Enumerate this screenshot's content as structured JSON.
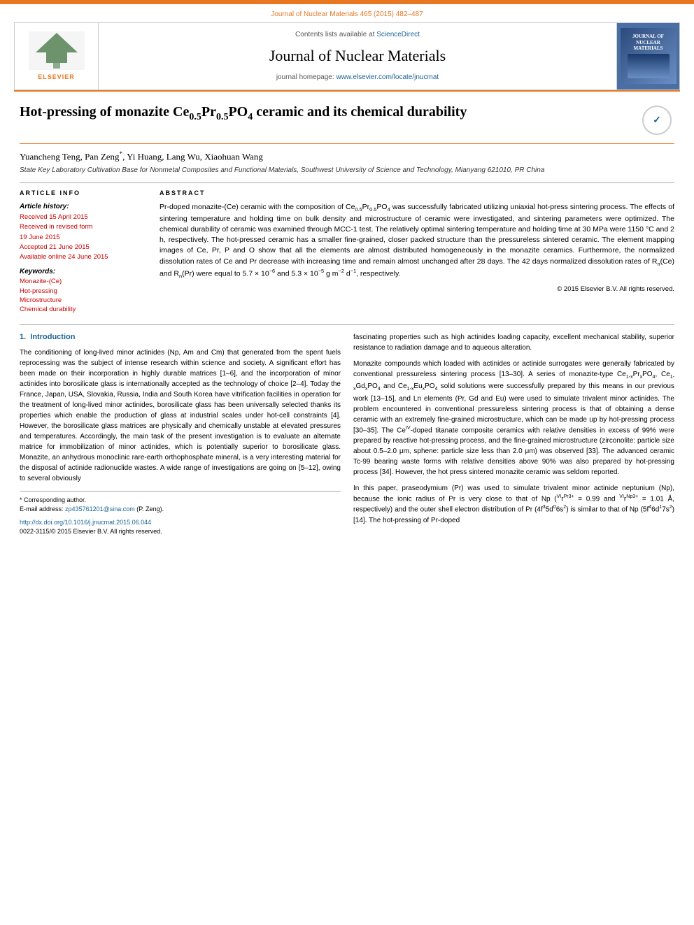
{
  "topBar": {
    "color": "#e87722"
  },
  "journalHeader": {
    "journalRef": "Journal of Nuclear Materials 465 (2015) 482–487",
    "contentsAvailable": "Contents lists available at",
    "scienceDirect": "ScienceDirect",
    "journalTitle": "Journal of Nuclear Materials",
    "homepageLabel": "journal homepage:",
    "homepageUrl": "www.elsevier.com/locate/jnucmat",
    "elsevierText": "ELSEVIER"
  },
  "paper": {
    "title": "Hot-pressing of monazite Ce₀.₅Pr₀.₅PO₄ ceramic and its chemical durability",
    "crossmark": "CrossMark",
    "authors": "Yuancheng Teng, Pan Zeng*, Yi Huang, Lang Wu, Xiaohuan Wang",
    "affiliation": "State Key Laboratory Cultivation Base for Nonmetal Composites and Functional Materials, Southwest University of Science and Technology, Mianyang 621010, PR China"
  },
  "articleInfo": {
    "header": "ARTICLE INFO",
    "historyLabel": "Article history:",
    "dates": [
      "Received 15 April 2015",
      "Received in revised form",
      "19 June 2015",
      "Accepted 21 June 2015",
      "Available online 24 June 2015"
    ],
    "keywordsLabel": "Keywords:",
    "keywords": [
      "Monazite-(Ce)",
      "Hot-pressing",
      "Microstructure",
      "Chemical durability"
    ]
  },
  "abstract": {
    "header": "ABSTRACT",
    "text": "Pr-doped monazite-(Ce) ceramic with the composition of Ce0.5Pr0.5PO4 was successfully fabricated utilizing uniaxial hot-press sintering process. The effects of sintering temperature and holding time on bulk density and microstructure of ceramic were investigated, and sintering parameters were optimized. The chemical durability of ceramic was examined through MCC-1 test. The relatively optimal sintering temperature and holding time at 30 MPa were 1150 °C and 2 h, respectively. The hot-pressed ceramic has a smaller fine-grained, closer packed structure than the pressureless sintered ceramic. The element mapping images of Ce, Pr, P and O show that all the elements are almost distributed homogeneously in the monazite ceramics. Furthermore, the normalized dissolution rates of Ce and Pr decrease with increasing time and remain almost unchanged after 28 days. The 42 days normalized dissolution rates of Rₙ(Ce) and Rₙ(Pr) were equal to 5.7 × 10⁻⁶ and 5.3 × 10⁻⁵ g m⁻² d⁻¹, respectively.",
    "copyright": "© 2015 Elsevier B.V. All rights reserved."
  },
  "sections": {
    "intro": {
      "title": "1.  Introduction",
      "leftCol": "The conditioning of long-lived minor actinides (Np, Am and Cm) that generated from the spent fuels reprocessing was the subject of intense research within science and society. A significant effort has been made on their incorporation in highly durable matrices [1–6], and the incorporation of minor actinides into borosilicate glass is internationally accepted as the technology of choice [2–4]. Today the France, Japan, USA, Slovakia, Russia, India and South Korea have vitrification facilities in operation for the treatment of long-lived minor actinides, borosilicate glass has been universally selected thanks its properties which enable the production of glass at industrial scales under hot-cell constraints [4]. However, the borosilicate glass matrices are physically and chemically unstable at elevated pressures and temperatures. Accordingly, the main task of the present investigation is to evaluate an alternate matrice for immobilization of minor actinides, which is potentially superior to borosilicate glass. Monazite, an anhydrous monoclinic rare-earth orthophosphate mineral, is a very interesting material for the disposal of actinide radionuclide wastes. A wide range of investigations are going on [5–12], owing to several obviously",
      "rightCol": "fascinating properties such as high actinides loading capacity, excellent mechanical stability, superior resistance to radiation damage and to aqueous alteration.\n\nMonazite compounds which loaded with actinides or actinide surrogates were generally fabricated by conventional pressureless sintering process [13–30]. A series of monazite-type Ce1-xPrxPO4, Ce1-xGdxPO4 and Ce1-xEuxPO4 solid solutions were successfully prepared by this means in our previous work [13–15], and Ln elements (Pr, Gd and Eu) were used to simulate trivalent minor actinides. The problem encountered in conventional pressureless sintering process is that of obtaining a dense ceramic with an extremely fine-grained microstructure, which can be made up by hot-pressing process [30–35]. The CeIV-doped titanate composite ceramics with relative densities in excess of 99% were prepared by reactive hot-pressing process, and the fine-grained microstructure (zirconolite: particle size about 0.5–2.0 μm, sphene: particle size less than 2.0 μm) was observed [33]. The advanced ceramic Tc-99 bearing waste forms with relative densities above 90% was also prepared by hot-pressing process [34]. However, the hot press sintered monazite ceramic was seldom reported.\n\nIn this paper, praseodymium (Pr) was used to simulate trivalent minor actinide neptunium (Np), because the ionic radius of Pr is very close to that of Np (VIrPr3+ = 0.99 and VIrNp3+ = 1.01 Å, respectively) and the outer shell electron distribution of Pr (4f³5d⁰6s²) is similar to that of Np (5f⁴6d¹7s²) [14]. The hot-pressing of Pr-doped"
    }
  },
  "footnote": {
    "correspondingAuthor": "* Corresponding author.",
    "emailLabel": "E-mail address:",
    "email": "zp435761201@sina.com",
    "emailSuffix": "(P. Zeng).",
    "doiLink": "http://dx.doi.org/10.1016/j.jnucmat.2015.06.044",
    "issn": "0022-3115/© 2015 Elsevier B.V. All rights reserved."
  }
}
